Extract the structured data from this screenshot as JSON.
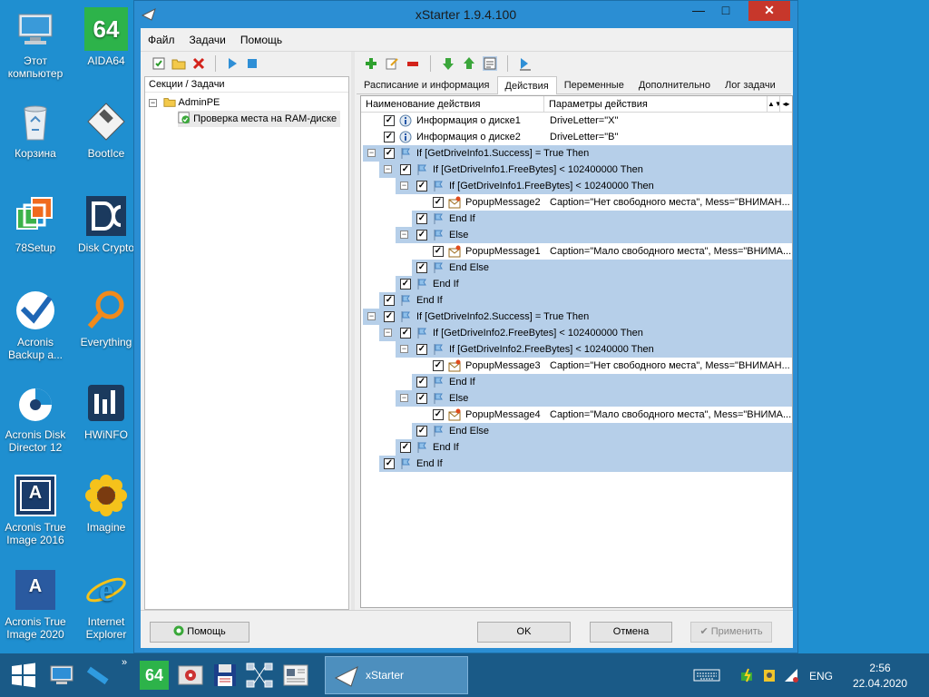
{
  "desktop": {
    "icons": [
      {
        "id": "this-pc",
        "label": "Этот компьютер"
      },
      {
        "id": "aida64",
        "label": "AIDA64"
      },
      {
        "id": "recycle-bin",
        "label": "Корзина"
      },
      {
        "id": "bootice",
        "label": "BootIce"
      },
      {
        "id": "78setup",
        "label": "78Setup"
      },
      {
        "id": "disk-crypto",
        "label": "Disk Crypto"
      },
      {
        "id": "acronis-backup",
        "label": "Acronis Backup a..."
      },
      {
        "id": "everything",
        "label": "Everything"
      },
      {
        "id": "acronis-disk-director",
        "label": "Acronis Disk Director 12"
      },
      {
        "id": "hwinfo",
        "label": "HWiNFO"
      },
      {
        "id": "acronis-true-image-2016",
        "label": "Acronis True Image 2016"
      },
      {
        "id": "imagine",
        "label": "Imagine"
      },
      {
        "id": "acronis-true-image-2020",
        "label": "Acronis True Image 2020"
      },
      {
        "id": "internet-explorer",
        "label": "Internet Explorer"
      }
    ],
    "aida_badge": "64",
    "acronis_letter": "A",
    "imagine_text": "Imagine"
  },
  "window": {
    "title": "xStarter 1.9.4.100",
    "controls": {
      "minimize": "—",
      "maximize": "□",
      "close": "✕"
    }
  },
  "menu": [
    "Файл",
    "Задачи",
    "Помощь"
  ],
  "tree": {
    "header": "Секции / Задачи",
    "nodes": [
      {
        "label": "AdminPE"
      },
      {
        "label": "Проверка места на RAM-диске"
      }
    ]
  },
  "tabs": [
    {
      "label": "Расписание и информация",
      "active": false
    },
    {
      "label": "Действия",
      "active": true
    },
    {
      "label": "Переменные",
      "active": false
    },
    {
      "label": "Дополнительно",
      "active": false
    },
    {
      "label": "Лог задачи",
      "active": false
    }
  ],
  "grid": {
    "col1": "Наименование действия",
    "col2": "Параметры действия",
    "rows": [
      {
        "level": 0,
        "toggle": "",
        "icon": "info",
        "name": "Информация о диске1",
        "params": "DriveLetter=\"X\"",
        "blue": false
      },
      {
        "level": 0,
        "toggle": "",
        "icon": "info",
        "name": "Информация о диске2",
        "params": "DriveLetter=\"B\"",
        "blue": false
      },
      {
        "level": 0,
        "toggle": "⊟",
        "icon": "flag",
        "name": "If [GetDriveInfo1.Success] = True Then",
        "params": "",
        "blue": true
      },
      {
        "level": 1,
        "toggle": "⊟",
        "icon": "flag",
        "name": "If [GetDriveInfo1.FreeBytes] < 102400000 Then",
        "params": "",
        "blue": true
      },
      {
        "level": 2,
        "toggle": "⊟",
        "icon": "flag",
        "name": "If [GetDriveInfo1.FreeBytes] < 10240000 Then",
        "params": "",
        "blue": true
      },
      {
        "level": 3,
        "toggle": "",
        "icon": "popup",
        "name": "PopupMessage2",
        "params": "Caption=\"Нет свободного места\", Mess=\"ВНИМАН...",
        "blue": false
      },
      {
        "level": 2,
        "toggle": "",
        "icon": "flag",
        "name": "End If",
        "params": "",
        "blue": true
      },
      {
        "level": 2,
        "toggle": "⊟",
        "icon": "flag",
        "name": "Else",
        "params": "",
        "blue": true
      },
      {
        "level": 3,
        "toggle": "",
        "icon": "popup",
        "name": "PopupMessage1",
        "params": "Caption=\"Мало свободного места\", Mess=\"ВНИМА...",
        "blue": false
      },
      {
        "level": 2,
        "toggle": "",
        "icon": "flag",
        "name": "End Else",
        "params": "",
        "blue": true
      },
      {
        "level": 1,
        "toggle": "",
        "icon": "flag",
        "name": "End If",
        "params": "",
        "blue": true
      },
      {
        "level": 0,
        "toggle": "",
        "icon": "flag",
        "name": "End If",
        "params": "",
        "blue": true
      },
      {
        "level": 0,
        "toggle": "⊟",
        "icon": "flag",
        "name": "If [GetDriveInfo2.Success] = True Then",
        "params": "",
        "blue": true
      },
      {
        "level": 1,
        "toggle": "⊟",
        "icon": "flag",
        "name": "If [GetDriveInfo2.FreeBytes] < 102400000 Then",
        "params": "",
        "blue": true
      },
      {
        "level": 2,
        "toggle": "⊟",
        "icon": "flag",
        "name": "If [GetDriveInfo2.FreeBytes] < 10240000 Then",
        "params": "",
        "blue": true
      },
      {
        "level": 3,
        "toggle": "",
        "icon": "popup",
        "name": "PopupMessage3",
        "params": "Caption=\"Нет свободного места\", Mess=\"ВНИМАН...",
        "blue": false
      },
      {
        "level": 2,
        "toggle": "",
        "icon": "flag",
        "name": "End If",
        "params": "",
        "blue": true
      },
      {
        "level": 2,
        "toggle": "⊟",
        "icon": "flag",
        "name": "Else",
        "params": "",
        "blue": true
      },
      {
        "level": 3,
        "toggle": "",
        "icon": "popup",
        "name": "PopupMessage4",
        "params": "Caption=\"Мало свободного места\", Mess=\"ВНИМА...",
        "blue": false
      },
      {
        "level": 2,
        "toggle": "",
        "icon": "flag",
        "name": "End Else",
        "params": "",
        "blue": true
      },
      {
        "level": 1,
        "toggle": "",
        "icon": "flag",
        "name": "End If",
        "params": "",
        "blue": true
      },
      {
        "level": 0,
        "toggle": "",
        "icon": "flag",
        "name": "End If",
        "params": "",
        "blue": true
      }
    ]
  },
  "buttons": {
    "help": "Помощь",
    "ok": "OK",
    "cancel": "Отмена",
    "apply": "Применить"
  },
  "taskbar": {
    "active_app": "xStarter",
    "lang": "ENG",
    "time": "2:56",
    "date": "22.04.2020",
    "aida_badge": "64"
  },
  "colors": {
    "desktop": "#1f8fd0",
    "row_highlight": "#b6cfe9",
    "taskbar": "#1a5a87"
  }
}
